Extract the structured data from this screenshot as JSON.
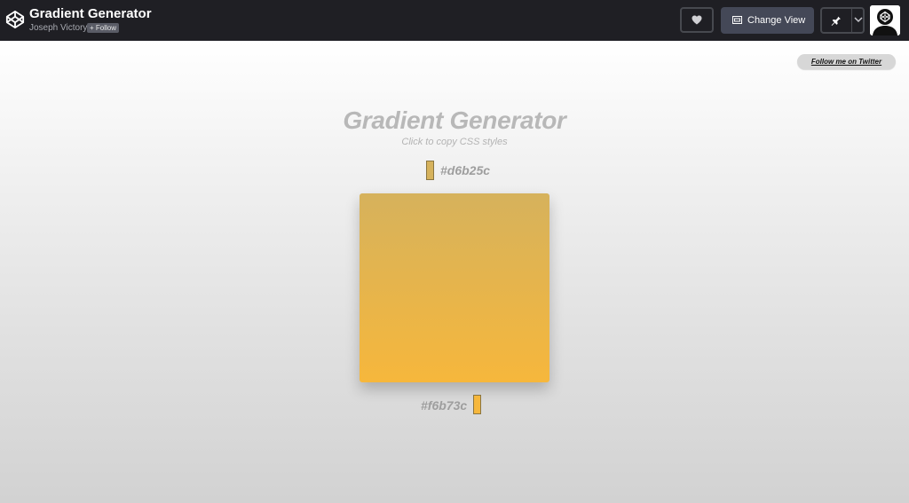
{
  "header": {
    "title": "Gradient Generator",
    "author": "Joseph Victory",
    "follow_label": "+ Follow",
    "change_view_label": "Change View",
    "brand_icon": "codepen-logo-icon",
    "heart_icon": "heart-icon",
    "layout_icon": "layout-icon",
    "pin_icon": "pin-icon",
    "chevron_icon": "chevron-down-icon",
    "avatar_icon": "codepen-avatar-icon"
  },
  "main": {
    "twitter_link": "Follow me on Twitter",
    "heading": "Gradient Generator",
    "subheading": "Click to copy CSS styles",
    "top_color": "#d6b25c",
    "bottom_color": "#f6b73c"
  },
  "colors": {
    "topbar_bg": "#1f1f24",
    "gradient_start": "#d6b25c",
    "gradient_end": "#f6b73c"
  }
}
